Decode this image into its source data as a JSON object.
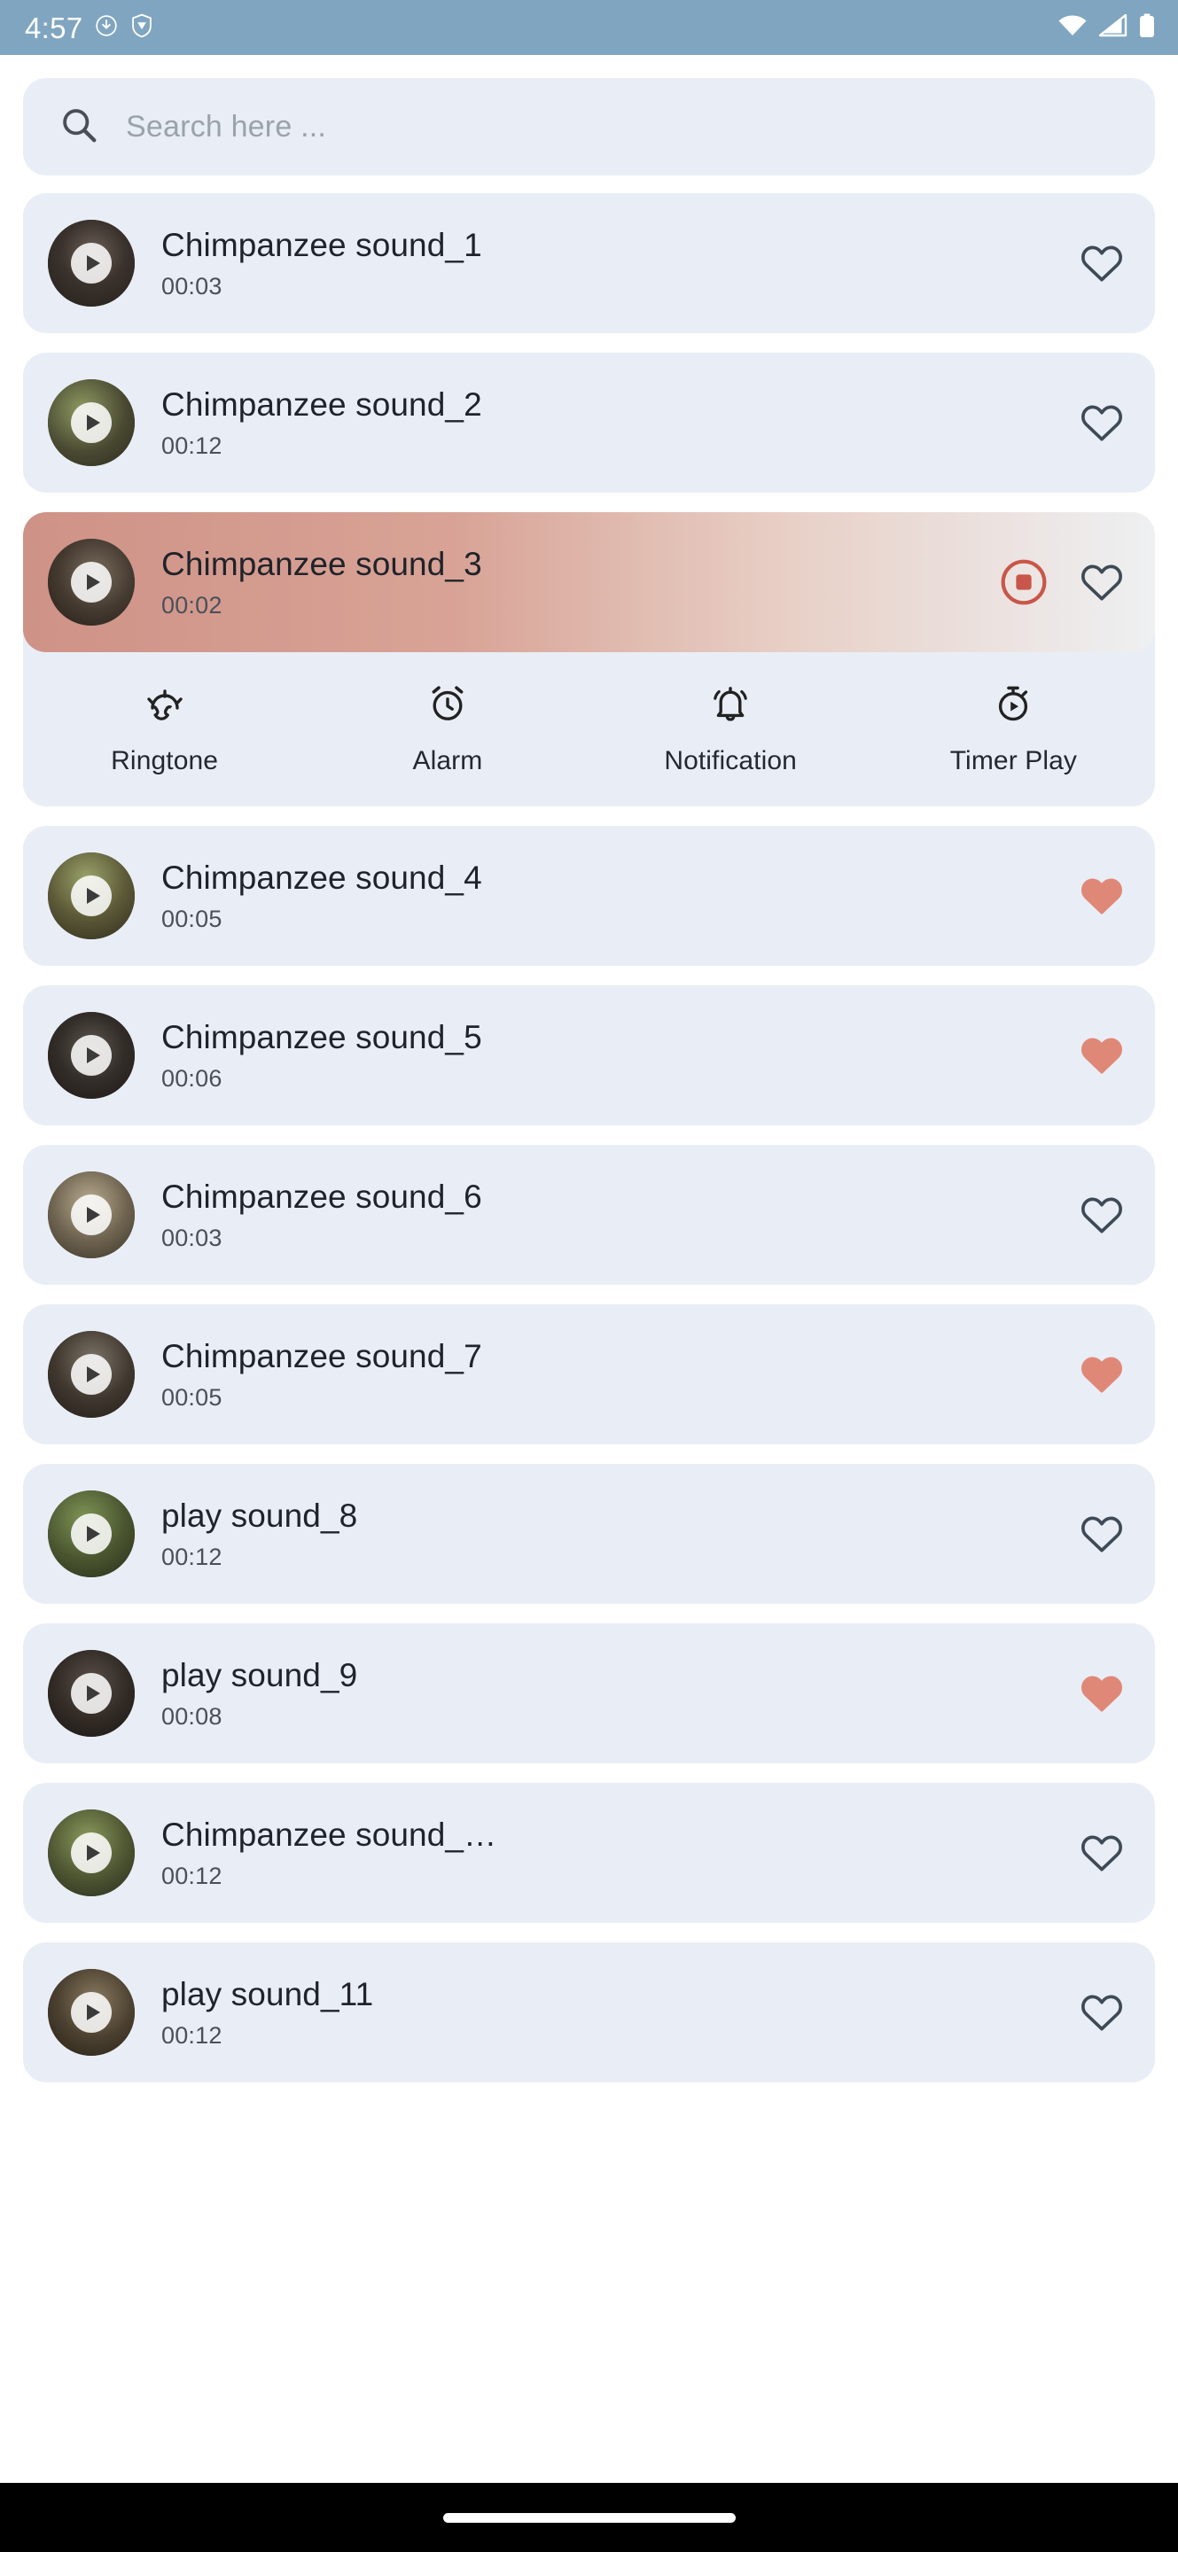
{
  "status_bar": {
    "time": "4:57",
    "left_icons": [
      "download-icon",
      "vpn-shield-icon"
    ],
    "right_icons": [
      "wifi-icon",
      "cellular-signal-icon",
      "battery-icon"
    ],
    "background_color": "#7fa5c0"
  },
  "search": {
    "placeholder": "Search here ...",
    "icon": "search-icon"
  },
  "theme": {
    "card_background": "#e9eef6",
    "accent_active": "#cf9287",
    "heart_filled": "#e08878",
    "heart_outline": "#3e4a56",
    "page_background": "#ffffff"
  },
  "expanded_actions": [
    {
      "label": "Ringtone",
      "icon": "ringtone-icon"
    },
    {
      "label": "Alarm",
      "icon": "alarm-clock-icon"
    },
    {
      "label": "Notification",
      "icon": "notification-bell-icon"
    },
    {
      "label": "Timer Play",
      "icon": "timer-play-icon"
    }
  ],
  "sounds": [
    {
      "title": "Chimpanzee sound_1",
      "duration": "00:03",
      "favorite": false,
      "playing": false,
      "expanded": false
    },
    {
      "title": "Chimpanzee sound_2",
      "duration": "00:12",
      "favorite": false,
      "playing": false,
      "expanded": false
    },
    {
      "title": "Chimpanzee sound_3",
      "duration": "00:02",
      "favorite": false,
      "playing": true,
      "expanded": true
    },
    {
      "title": "Chimpanzee sound_4",
      "duration": "00:05",
      "favorite": true,
      "playing": false,
      "expanded": false
    },
    {
      "title": "Chimpanzee sound_5",
      "duration": "00:06",
      "favorite": true,
      "playing": false,
      "expanded": false
    },
    {
      "title": "Chimpanzee sound_6",
      "duration": "00:03",
      "favorite": false,
      "playing": false,
      "expanded": false
    },
    {
      "title": "Chimpanzee sound_7",
      "duration": "00:05",
      "favorite": true,
      "playing": false,
      "expanded": false
    },
    {
      "title": "play sound_8",
      "duration": "00:12",
      "favorite": false,
      "playing": false,
      "expanded": false
    },
    {
      "title": "play sound_9",
      "duration": "00:08",
      "favorite": true,
      "playing": false,
      "expanded": false
    },
    {
      "title": "Chimpanzee sound_…",
      "duration": "00:12",
      "favorite": false,
      "playing": false,
      "expanded": false
    },
    {
      "title": "play sound_11",
      "duration": "00:12",
      "favorite": false,
      "playing": false,
      "expanded": false
    }
  ],
  "bottom_nav": {
    "gesture_pill": "home-gesture-pill"
  }
}
